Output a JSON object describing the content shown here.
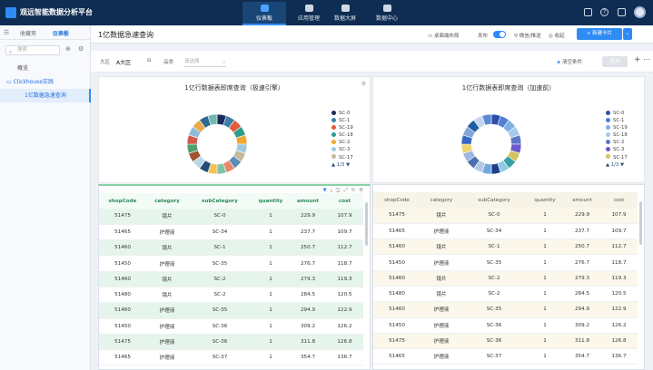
{
  "brand": "观远智能数据分析平台",
  "nav": [
    {
      "label": "仪表板",
      "active": true
    },
    {
      "label": "应用管理",
      "active": false
    },
    {
      "label": "数据大屏",
      "active": false
    },
    {
      "label": "数据中心",
      "active": false
    }
  ],
  "top_icons": [
    "window-icon",
    "help-icon",
    "grid-icon",
    "bell-icon"
  ],
  "sidebar": {
    "tabs": [
      "收藏夹",
      "仪表板"
    ],
    "search_placeholder": "搜索",
    "items": [
      {
        "label": "概览",
        "type": "page"
      },
      {
        "label": "Clickhouse实践",
        "type": "folder"
      },
      {
        "label": "1亿数据急速查询",
        "type": "page",
        "selected": true
      }
    ]
  },
  "dashboard": {
    "title": "1亿数据急速查询",
    "toolbar": {
      "layout": "桌面端布局",
      "publish": "发布",
      "publish_on": true,
      "subscribe": "微信/推送",
      "favorite": "收起",
      "new_card": "新建卡片"
    },
    "filters": [
      {
        "label": "大区",
        "value": "A大区"
      },
      {
        "label": "品类",
        "value": "",
        "placeholder": "请选择"
      }
    ],
    "clear": "清空条件",
    "apply": "应用"
  },
  "charts": [
    {
      "title": "1亿行数据表即席查询（极速引擎）"
    },
    {
      "title": "1亿行数据表即席查询（加速前）"
    }
  ],
  "legend_left": {
    "items": [
      "SC-0",
      "SC-1",
      "SC-19",
      "SC-18",
      "SC-2",
      "SC-3",
      "SC-17"
    ],
    "colors": [
      "#1a2a5a",
      "#3d7fa8",
      "#e25c3b",
      "#2d9c8c",
      "#f0a830",
      "#9ecae1",
      "#c7b89a"
    ],
    "pager": "1/3"
  },
  "legend_right": {
    "items": [
      "SC-0",
      "SC-1",
      "SC-19",
      "SC-18",
      "SC-2",
      "SC-3",
      "SC-17"
    ],
    "colors": [
      "#2c4fa8",
      "#4f7fd6",
      "#7fb0e6",
      "#a7c9ec",
      "#5c78c8",
      "#6a5acd",
      "#d6c25a"
    ],
    "pager": "1/3"
  },
  "chart_data": [
    {
      "type": "pie",
      "title": "1亿行数据表即席查询（极速引擎）",
      "labels": [
        "SC-0",
        "SC-1",
        "SC-19",
        "SC-18",
        "SC-2",
        "SC-3",
        "SC-17"
      ],
      "legend_pages": "1/3",
      "note": "slice values not printed"
    },
    {
      "type": "pie",
      "title": "1亿行数据表即席查询（加速前）",
      "labels": [
        "SC-0",
        "SC-1",
        "SC-19",
        "SC-18",
        "SC-2",
        "SC-3",
        "SC-17"
      ],
      "legend_pages": "1/3",
      "note": "slice values not printed"
    }
  ],
  "donut_left_colors": [
    "#1a2a5a",
    "#3d7fa8",
    "#e25c3b",
    "#2d9c8c",
    "#f0a830",
    "#9ecae1",
    "#c7b89a",
    "#5b8db8",
    "#e9856b",
    "#7ec4a8",
    "#f3c25b",
    "#254b78",
    "#b9d7ea",
    "#a0522d",
    "#4f9e6b",
    "#d35a4a",
    "#8fbcd8",
    "#e8a94c",
    "#2f6a8f",
    "#76b7b2"
  ],
  "donut_right_colors": [
    "#2c4fa8",
    "#4f7fd6",
    "#7fb0e6",
    "#a7c9ec",
    "#5c78c8",
    "#6a5acd",
    "#d6c25a",
    "#3aa0a8",
    "#8ecae6",
    "#1e3f8a",
    "#6fa8dc",
    "#b4c7e7",
    "#4d6fb0",
    "#9db8e2",
    "#f0d36a",
    "#3466c2",
    "#82a6d9",
    "#1f5fa0",
    "#c2d6f0",
    "#5a8ad0"
  ],
  "table": {
    "columns": [
      "shopCode",
      "category",
      "subCategory",
      "quantity",
      "amount",
      "cost"
    ],
    "rows": [
      [
        "51475",
        "镜片",
        "SC-0",
        "1",
        "229.9",
        "107.9"
      ],
      [
        "51465",
        "护理液",
        "SC-34",
        "1",
        "237.7",
        "109.7"
      ],
      [
        "51460",
        "镜片",
        "SC-1",
        "1",
        "250.7",
        "112.7"
      ],
      [
        "51450",
        "护理液",
        "SC-35",
        "1",
        "276.7",
        "118.7"
      ],
      [
        "51460",
        "镜片",
        "SC-2",
        "1",
        "279.3",
        "119.3"
      ],
      [
        "51480",
        "镜片",
        "SC-2",
        "1",
        "284.5",
        "120.5"
      ],
      [
        "51460",
        "护理液",
        "SC-35",
        "1",
        "294.9",
        "122.9"
      ],
      [
        "51450",
        "护理液",
        "SC-36",
        "1",
        "309.2",
        "126.2"
      ],
      [
        "51475",
        "护理液",
        "SC-36",
        "1",
        "311.8",
        "126.8"
      ],
      [
        "51465",
        "护理液",
        "SC-37",
        "1",
        "354.7",
        "136.7"
      ]
    ]
  }
}
